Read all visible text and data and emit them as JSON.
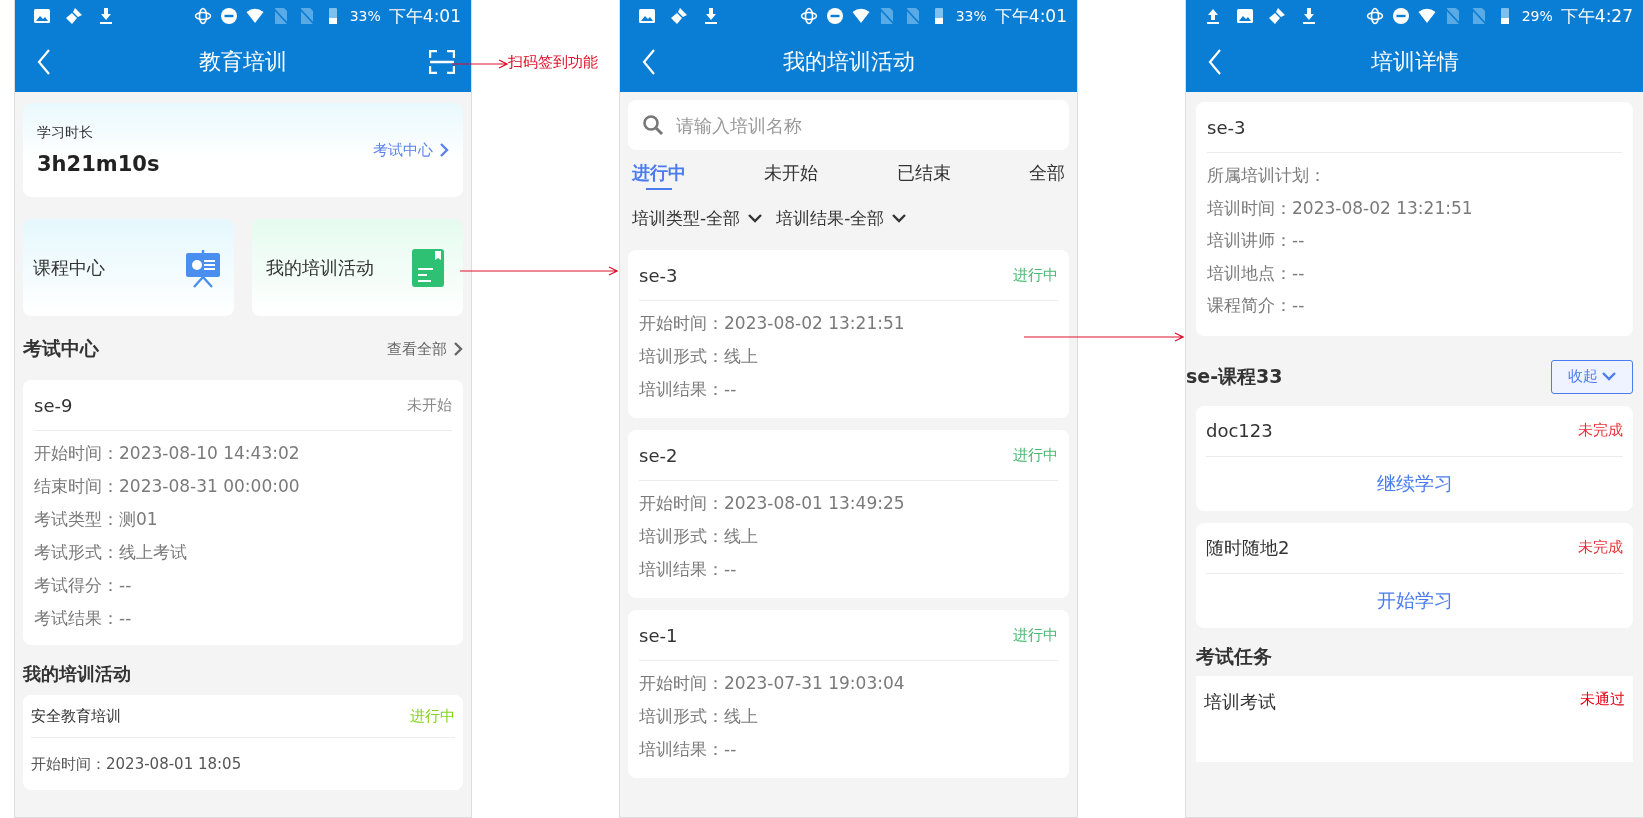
{
  "annotation": {
    "label": "扫码签到功能"
  },
  "home": {
    "status_bar": {
      "battery": "33%",
      "time": "下午4:01"
    },
    "header": {
      "title": "教育培训"
    },
    "study_card": {
      "label": "学习时长",
      "value": "3h21m10s",
      "link": "考试中心"
    },
    "entries": [
      {
        "label": "课程中心",
        "kind": "course"
      },
      {
        "label": "我的培训活动",
        "kind": "activity"
      }
    ],
    "exam_section": {
      "title": "考试中心",
      "more": "查看全部"
    },
    "exam_card": {
      "title": "se-9",
      "status": "未开始",
      "color": "#888888",
      "fields": [
        "开始时间：2023-08-10 14:43:02",
        "结束时间：2023-08-31 00:00:00",
        "考试类型：测01",
        "考试形式：线上考试",
        "考试得分：--",
        "考试结果：--"
      ]
    },
    "activity_section": {
      "title": "我的培训活动"
    },
    "activity_card": {
      "title": "安全教育培训",
      "status": "进行中",
      "color": "#84d41a",
      "fields": [
        "开始时间：2023-08-01 18:05"
      ]
    }
  },
  "activities": {
    "status_bar": {
      "battery": "33%",
      "time": "下午4:01"
    },
    "header": {
      "title": "我的培训活动"
    },
    "search": {
      "placeholder": "请输入培训名称"
    },
    "tabs": [
      {
        "label": "进行中",
        "selected": true
      },
      {
        "label": "未开始",
        "selected": false
      },
      {
        "label": "已结束",
        "selected": false
      },
      {
        "label": "全部",
        "selected": false
      }
    ],
    "filters": [
      "培训类型-全部",
      "培训结果-全部"
    ],
    "cards": [
      {
        "title": "se-3",
        "status": "进行中",
        "color": "#4cb872",
        "fields": [
          "开始时间：2023-08-02 13:21:51",
          "培训形式：线上",
          "培训结果：--"
        ]
      },
      {
        "title": "se-2",
        "status": "进行中",
        "color": "#4cb872",
        "fields": [
          "开始时间：2023-08-01 13:49:25",
          "培训形式：线上",
          "培训结果：--"
        ]
      },
      {
        "title": "se-1",
        "status": "进行中",
        "color": "#4cb872",
        "fields": [
          "开始时间：2023-07-31 19:03:04",
          "培训形式：线上",
          "培训结果：--"
        ]
      }
    ]
  },
  "detail": {
    "status_bar": {
      "battery": "29%",
      "time": "下午4:27"
    },
    "header": {
      "title": "培训详情"
    },
    "info_card": {
      "title": "se-3",
      "fields": [
        "所属培训计划：",
        "培训时间：2023-08-02 13:21:51",
        "培训讲师：--",
        "培训地点：--",
        "课程简介：--"
      ]
    },
    "course_section": {
      "title": "se-课程33",
      "toggle": "收起"
    },
    "courses": [
      {
        "title": "doc123",
        "status": "未完成",
        "color": "#e8313a",
        "action": "继续学习"
      },
      {
        "title": "随时随地2",
        "status": "未完成",
        "color": "#e8313a",
        "action": "开始学习"
      }
    ],
    "exam_section": {
      "title": "考试任务"
    },
    "exam_card": {
      "title": "培训考试",
      "status": "未通过",
      "color": "#e60012"
    }
  }
}
